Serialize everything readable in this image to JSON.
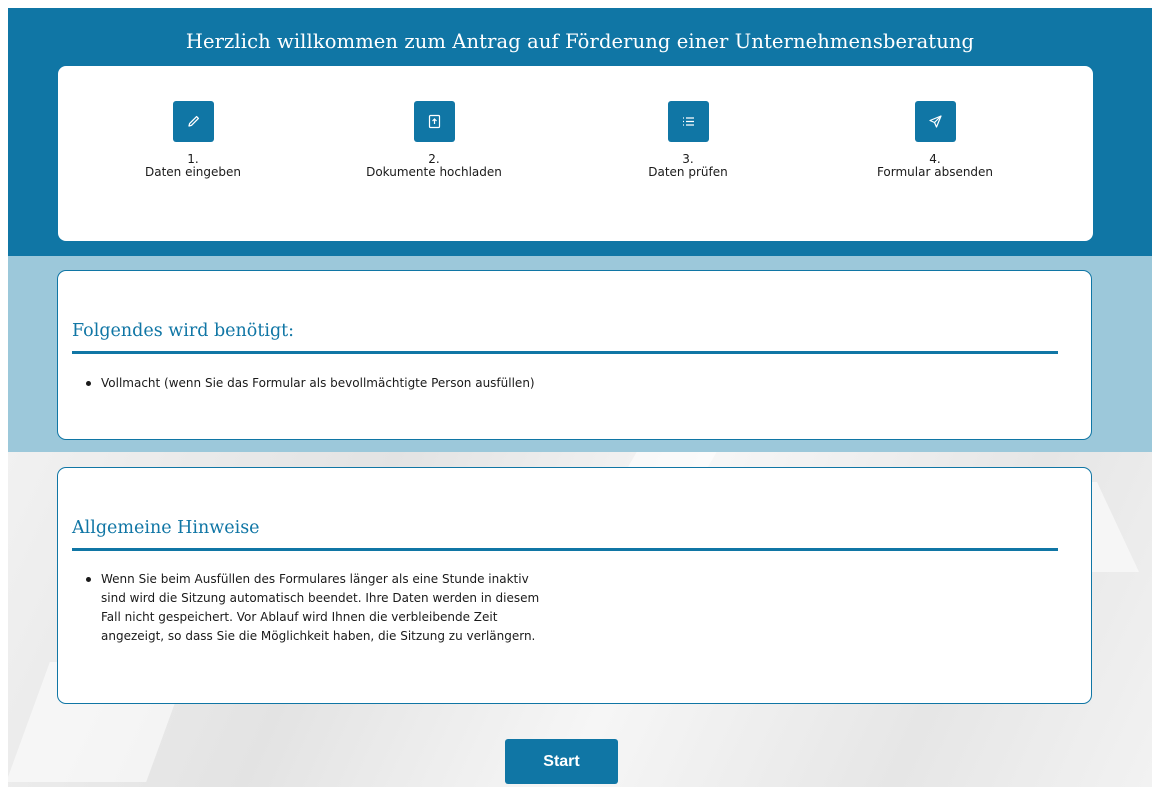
{
  "header": {
    "title": "Herzlich willkommen zum Antrag auf Förderung einer Unternehmensberatung"
  },
  "steps": [
    {
      "number": "1.",
      "label": "Daten eingeben",
      "icon": "pencil-icon"
    },
    {
      "number": "2.",
      "label": "Dokumente hochladen",
      "icon": "upload-document-icon"
    },
    {
      "number": "3.",
      "label": "Daten prüfen",
      "icon": "checklist-icon"
    },
    {
      "number": "4.",
      "label": "Formular absenden",
      "icon": "send-icon"
    }
  ],
  "requirements": {
    "heading": "Folgendes wird benötigt:",
    "items": [
      "Vollmacht (wenn Sie das Formular als bevollmächtigte Person ausfüllen)"
    ]
  },
  "notes": {
    "heading": "Allgemeine Hinweise",
    "items": [
      "Wenn Sie beim Ausfüllen des Formulares länger als eine Stunde inaktiv sind wird die Sitzung automatisch beendet. Ihre Daten werden in diesem Fall nicht gespeichert. Vor Ablauf wird Ihnen die verbleibende Zeit angezeigt, so dass Sie die Möglichkeit haben, die Sitzung zu verlängern."
    ]
  },
  "actions": {
    "start_label": "Start"
  },
  "colors": {
    "primary": "#1076a5",
    "light_band": "#9cc8da"
  }
}
